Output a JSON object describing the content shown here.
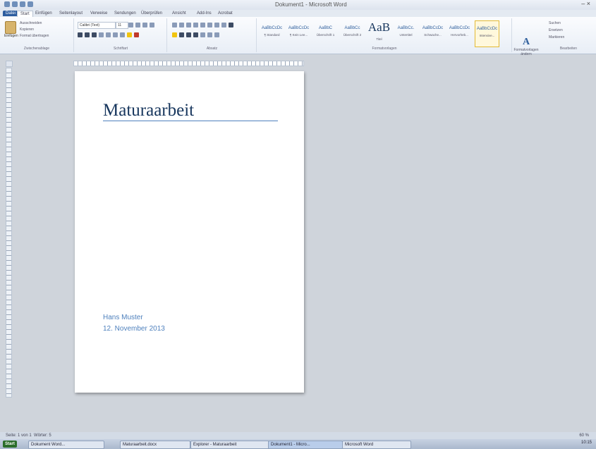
{
  "window": {
    "title": "Dokument1 - Microsoft Word",
    "controls": "– ×"
  },
  "tabs": [
    "Datei",
    "Start",
    "Einfügen",
    "Seitenlayout",
    "Verweise",
    "Sendungen",
    "Überprüfen",
    "Ansicht",
    "Add-Ins",
    "Acrobat"
  ],
  "ribbon": {
    "clipboard": {
      "paste_label": "Einfügen",
      "cut": "Ausschneiden",
      "copy": "Kopieren",
      "format": "Format übertragen",
      "group_label": "Zwischenablage"
    },
    "font": {
      "font_name": "Calibri (Text)",
      "font_size": "11",
      "group_label": "Schriftart"
    },
    "paragraph": {
      "group_label": "Absatz"
    },
    "styles": {
      "items": [
        {
          "preview": "AaBbCcDc",
          "name": "¶ Standard"
        },
        {
          "preview": "AaBbCcDc",
          "name": "¶ Kein Lee..."
        },
        {
          "preview": "AaBbC",
          "name": "Überschrift 1"
        },
        {
          "preview": "AaBbCc",
          "name": "Überschrift 2"
        },
        {
          "preview": "AaB",
          "name": "Titel"
        },
        {
          "preview": "AaBbCc.",
          "name": "Untertitel"
        },
        {
          "preview": "AaBbCcDc",
          "name": "Schwache..."
        },
        {
          "preview": "AaBbCcDc",
          "name": "Hervorheb..."
        },
        {
          "preview": "AaBbCcDc",
          "name": "Intensive..."
        }
      ],
      "selected_index": 8,
      "change_styles": "Formatvorlagen ändern",
      "group_label": "Formatvorlagen"
    },
    "editing": {
      "find": "Suchen",
      "replace": "Ersetzen",
      "select": "Markieren",
      "group_label": "Bearbeiten"
    }
  },
  "document": {
    "title": "Maturaarbeit",
    "author": "Hans Muster",
    "date": "12. November 2013"
  },
  "statusbar": {
    "page": "Seite: 1 von 1",
    "words": "Wörter: 5",
    "zoom": "60 %"
  },
  "taskbar": {
    "start": "Start",
    "items": [
      "Dokument Word...",
      "Maturaarbeit.docx",
      "Explorer - Maturaarbeit",
      "Dokument1 - Micro...",
      "Microsoft Word"
    ],
    "clock": "10:15"
  }
}
